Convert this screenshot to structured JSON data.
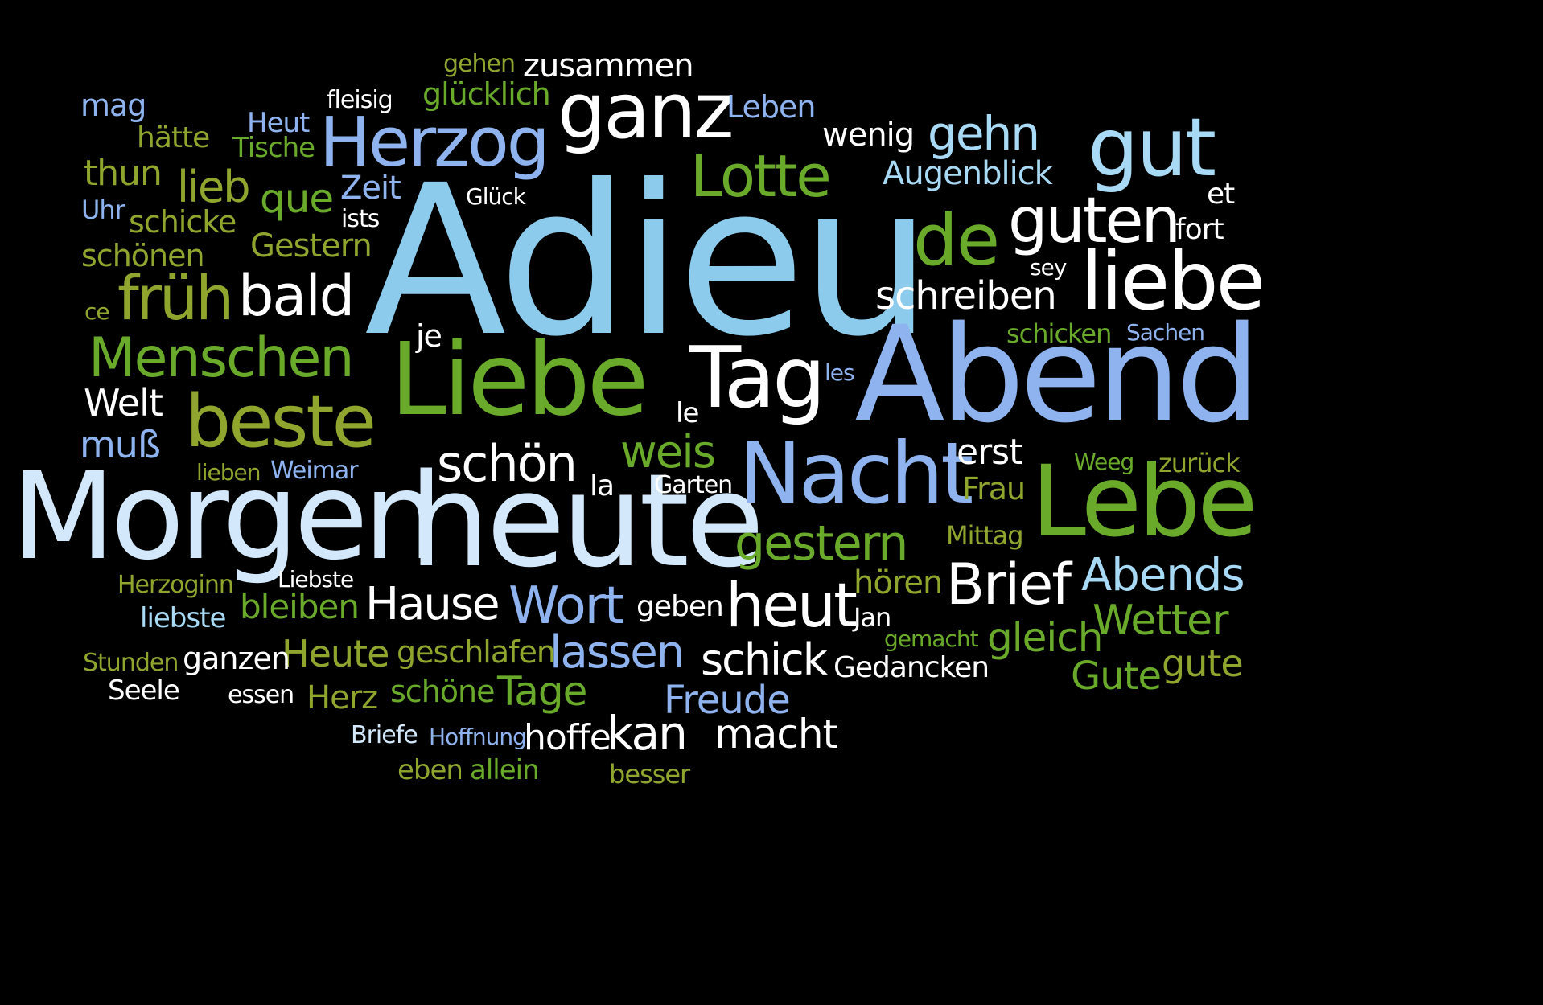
{
  "colors": {
    "background": "#000000",
    "green": "#6aaa2a",
    "olive": "#8fa52e",
    "white": "#ffffff",
    "light_blue": "#a8daf5",
    "sky_blue": "#8ccbec",
    "periwinkle": "#8eb3ef",
    "pale_blue": "#d3e9fb"
  },
  "words": [
    "Adieu",
    "Morgen",
    "heute",
    "Abend",
    "Liebe",
    "Lebe",
    "Nacht",
    "Tag",
    "Herzog",
    "ganz",
    "gut",
    "liebe",
    "beste",
    "guten",
    "Lotte",
    "de",
    "früh",
    "Menschen",
    "bald",
    "schön",
    "Wort",
    "Brief",
    "heut",
    "gestern",
    "Abends",
    "Hause",
    "lassen",
    "kan",
    "weis",
    "schick",
    "gehn",
    "Wetter",
    "Freude",
    "Tage",
    "schreiben",
    "lieb",
    "que",
    "macht",
    "zusammen",
    "hoffe",
    "gleich",
    "Gute",
    "gute",
    "Heute",
    "Augenblick",
    "erst",
    "glücklich",
    "bleiben",
    "Herz",
    "Leben",
    "wenig",
    "thun",
    "schöne",
    "geschlafen",
    "muß",
    "Welt",
    "Zeit",
    "Gestern",
    "schicke",
    "Gedancken",
    "hören",
    "mag",
    "hätte",
    "schönen",
    "geben",
    "Frau",
    "ganzen",
    "Heut",
    "Tische",
    "la",
    "Garten",
    "je",
    "Mittag",
    "liebste",
    "Seele",
    "Weimar",
    "essen",
    "schicken",
    "eben",
    "allein",
    "Jan",
    "le",
    "zurück",
    "Weeg",
    "besser",
    "Uhr",
    "gehen",
    "fleisig",
    "Stunden",
    "Herzoginn",
    "Liebste",
    "Briefe",
    "Hoffnung",
    "lieben",
    "les",
    "Sachen",
    "gemacht",
    "ists",
    "Glück",
    "ce",
    "sey",
    "fort",
    "et"
  ]
}
